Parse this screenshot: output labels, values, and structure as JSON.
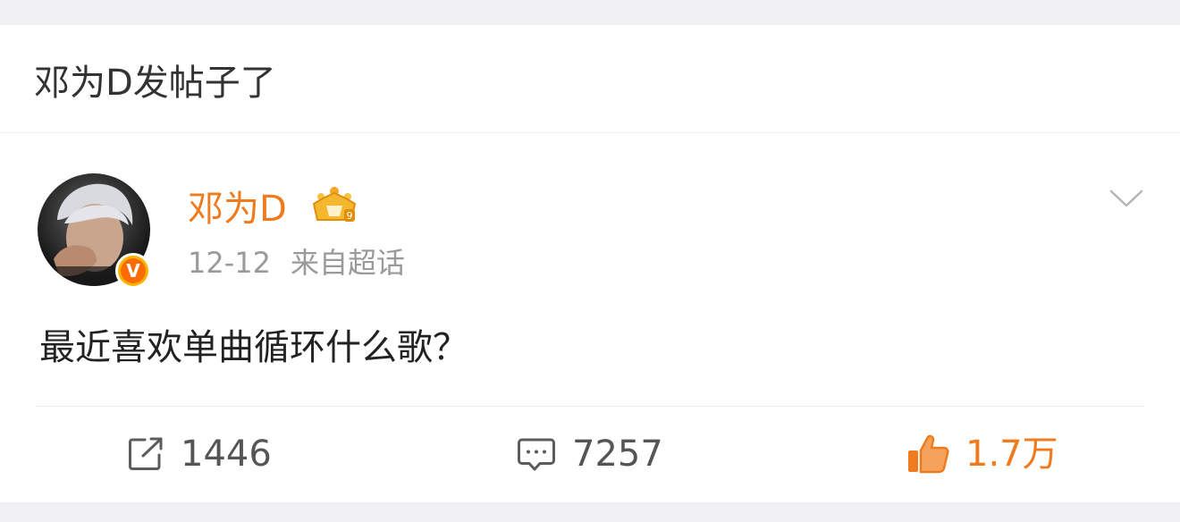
{
  "header": {
    "title": "邓为D发帖子了"
  },
  "post": {
    "author": {
      "name": "邓为D",
      "verified_badge_text": "V",
      "vip_badge": "crown-icon"
    },
    "date": "12-12",
    "source": "来自超话",
    "text": "最近喜欢单曲循环什么歌？"
  },
  "actions": {
    "repost_count": "1446",
    "comment_count": "7257",
    "like_count": "1.7万"
  },
  "colors": {
    "accent": "#f07b1e",
    "meta_gray": "#9a9a9a",
    "background": "#f0f0f3"
  }
}
